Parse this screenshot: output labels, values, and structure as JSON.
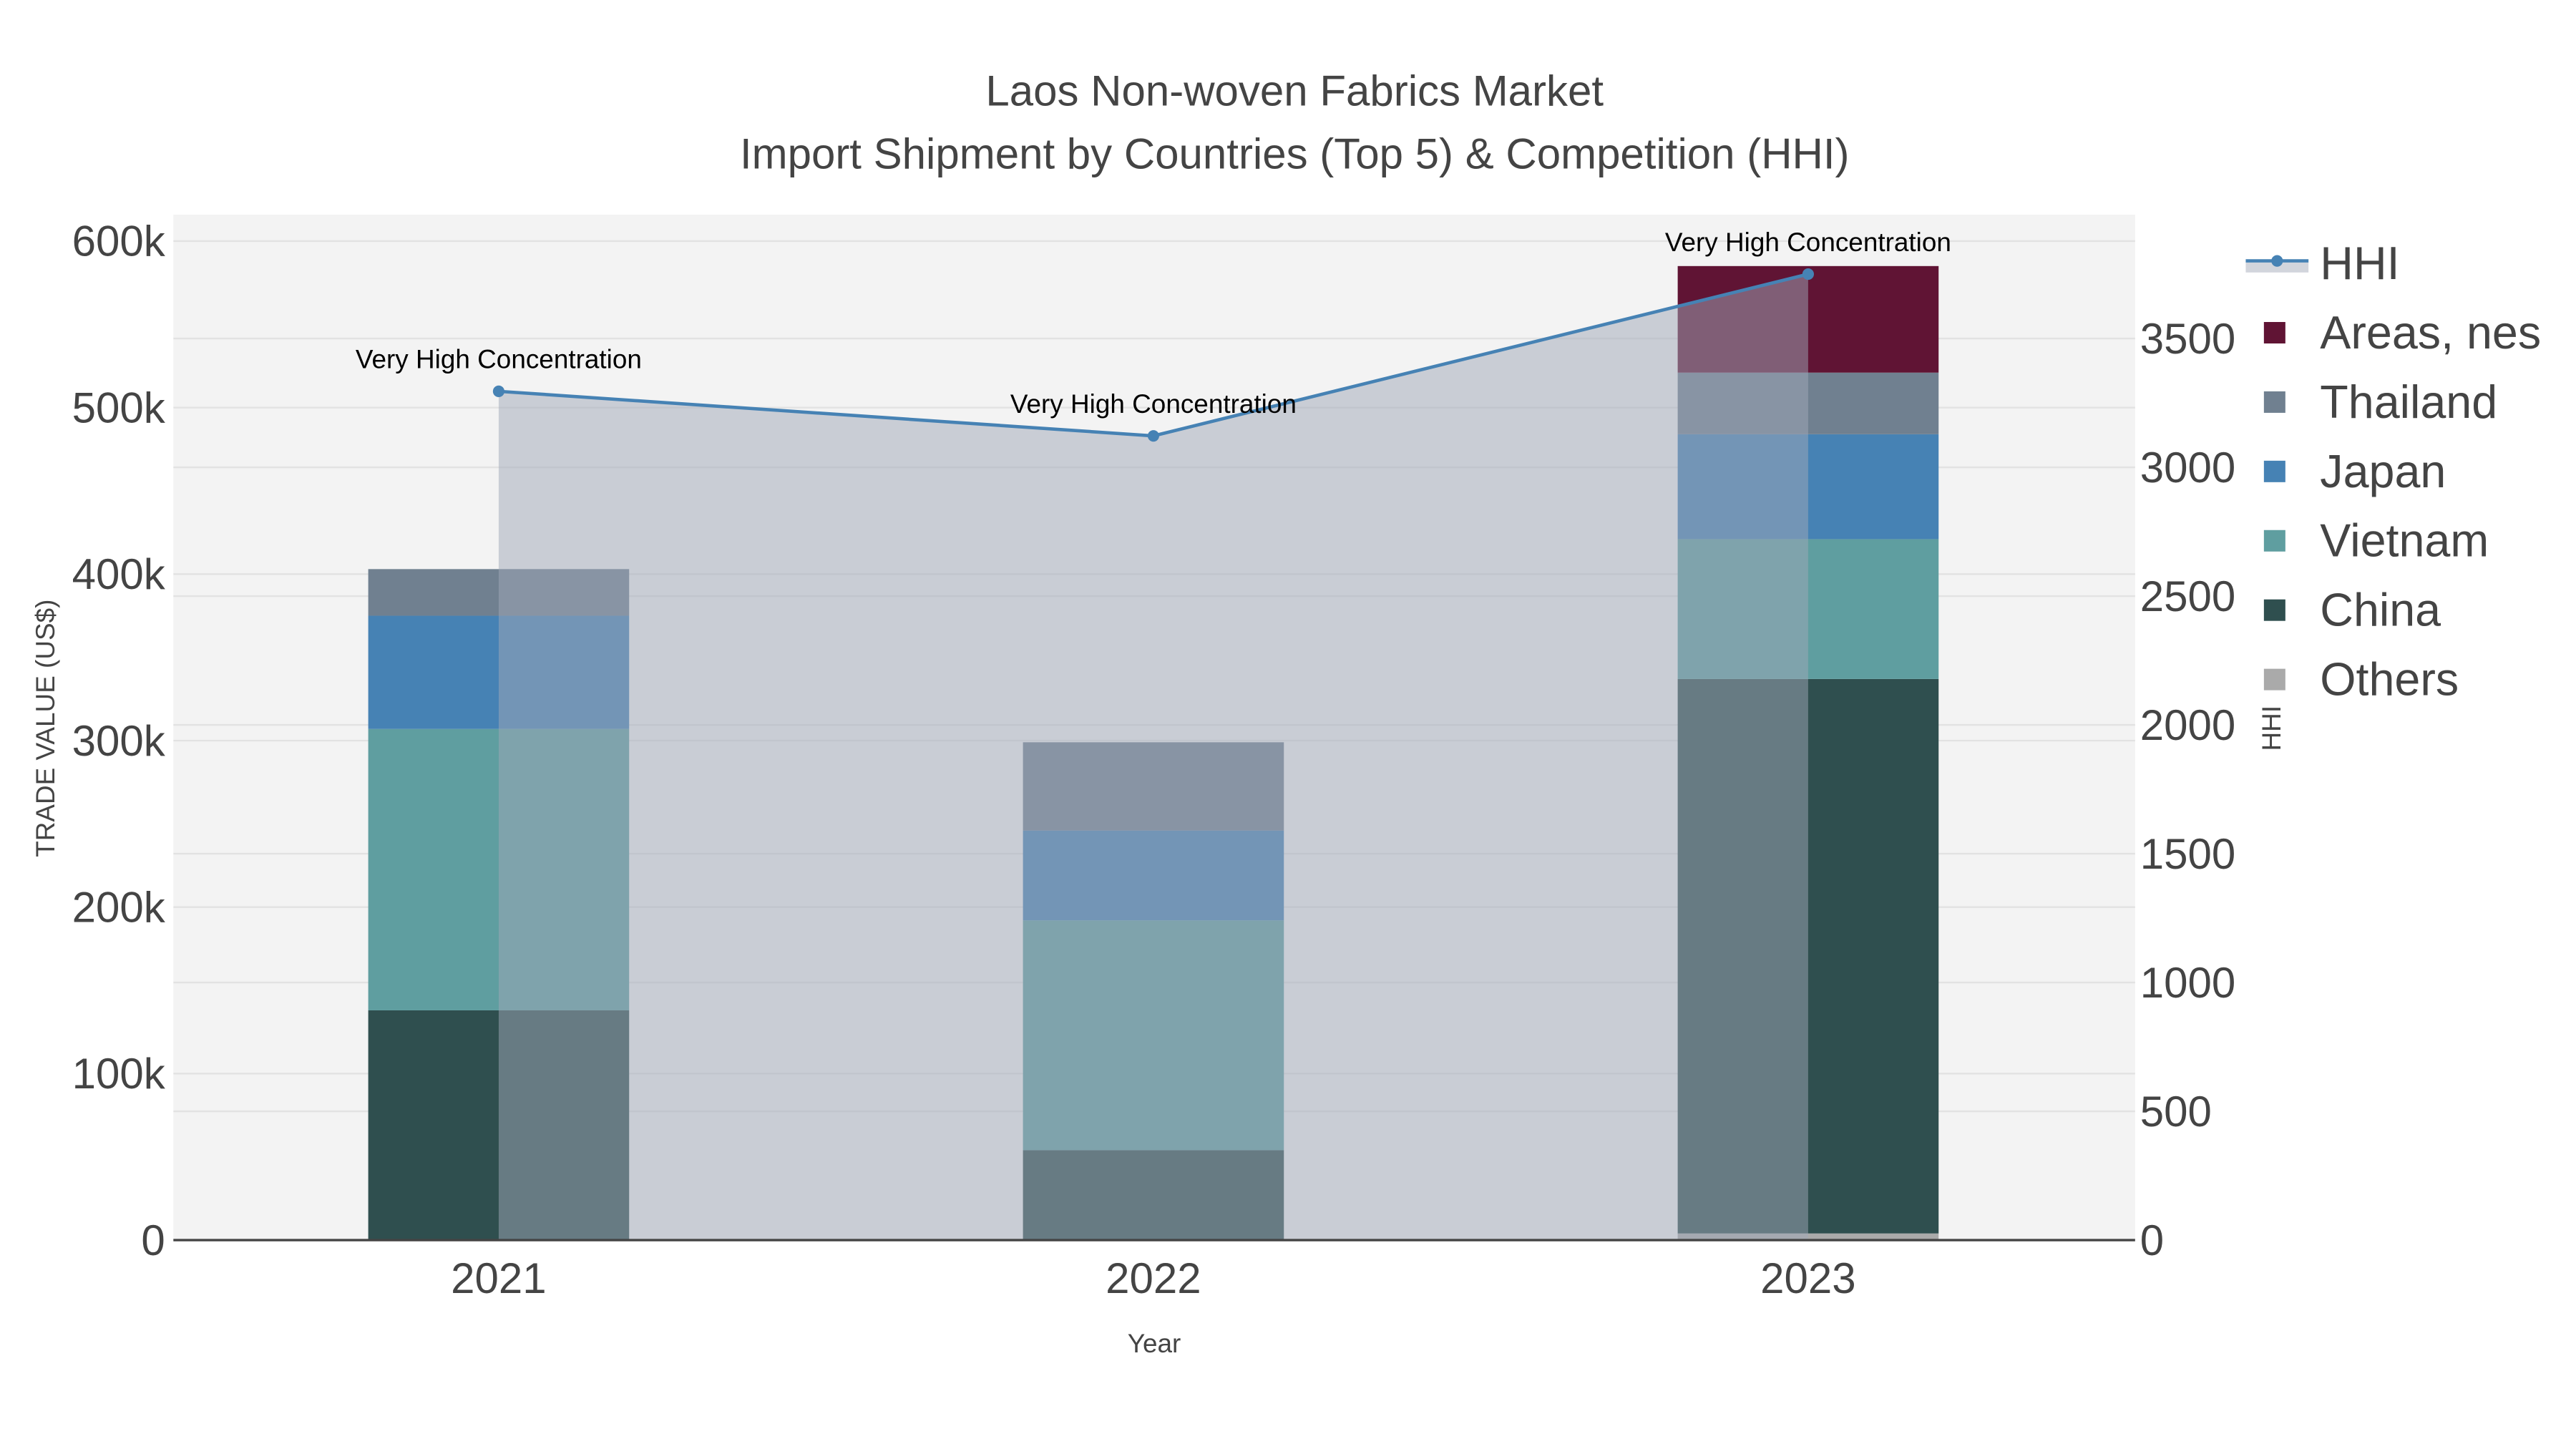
{
  "chart_data": {
    "type": "bar",
    "title": "Laos Non-woven Fabrics Market",
    "subtitle": "Import Shipment by Countries (Top 5) & Competition (HHI)",
    "xlabel": "Year",
    "ylabel": "TRADE VALUE (US$)",
    "y2label": "HHI",
    "categories": [
      "2021",
      "2022",
      "2023"
    ],
    "ylim": [
      0,
      615000
    ],
    "y_ticks": [
      "0",
      "100k",
      "200k",
      "300k",
      "400k",
      "500k",
      "600k"
    ],
    "y_tick_values": [
      0,
      100000,
      200000,
      300000,
      400000,
      500000,
      600000
    ],
    "y2lim": [
      0,
      3940
    ],
    "y2_ticks": [
      "0",
      "500",
      "1000",
      "1500",
      "2000",
      "2500",
      "3000",
      "3500"
    ],
    "y2_tick_values": [
      0,
      500,
      1000,
      1500,
      2000,
      2500,
      3000,
      3500
    ],
    "stacked": true,
    "grid": true,
    "legend_position": "right",
    "series": [
      {
        "name": "Others",
        "color": "#aaaaaa",
        "values": [
          0,
          0,
          4000
        ]
      },
      {
        "name": "China",
        "color": "#2f4f4f",
        "values": [
          138000,
          54000,
          333000
        ]
      },
      {
        "name": "Vietnam",
        "color": "#5f9ea0",
        "values": [
          169000,
          138000,
          84000
        ]
      },
      {
        "name": "Japan",
        "color": "#4682b4",
        "values": [
          68000,
          54000,
          63000
        ]
      },
      {
        "name": "Thailand",
        "color": "#708090",
        "values": [
          28000,
          53000,
          37000
        ]
      },
      {
        "name": "Areas, nes",
        "color": "#601434",
        "values": [
          0,
          0,
          64000
        ]
      }
    ],
    "line": {
      "name": "HHI",
      "color": "#4682b4",
      "axis": "right",
      "values": [
        3295,
        3122,
        3750
      ],
      "annotations": [
        "Very High Concentration",
        "Very High Concentration",
        "Very High Concentration"
      ]
    },
    "legend_order": [
      "HHI",
      "Areas, nes",
      "Thailand",
      "Japan",
      "Vietnam",
      "China",
      "Others"
    ]
  }
}
